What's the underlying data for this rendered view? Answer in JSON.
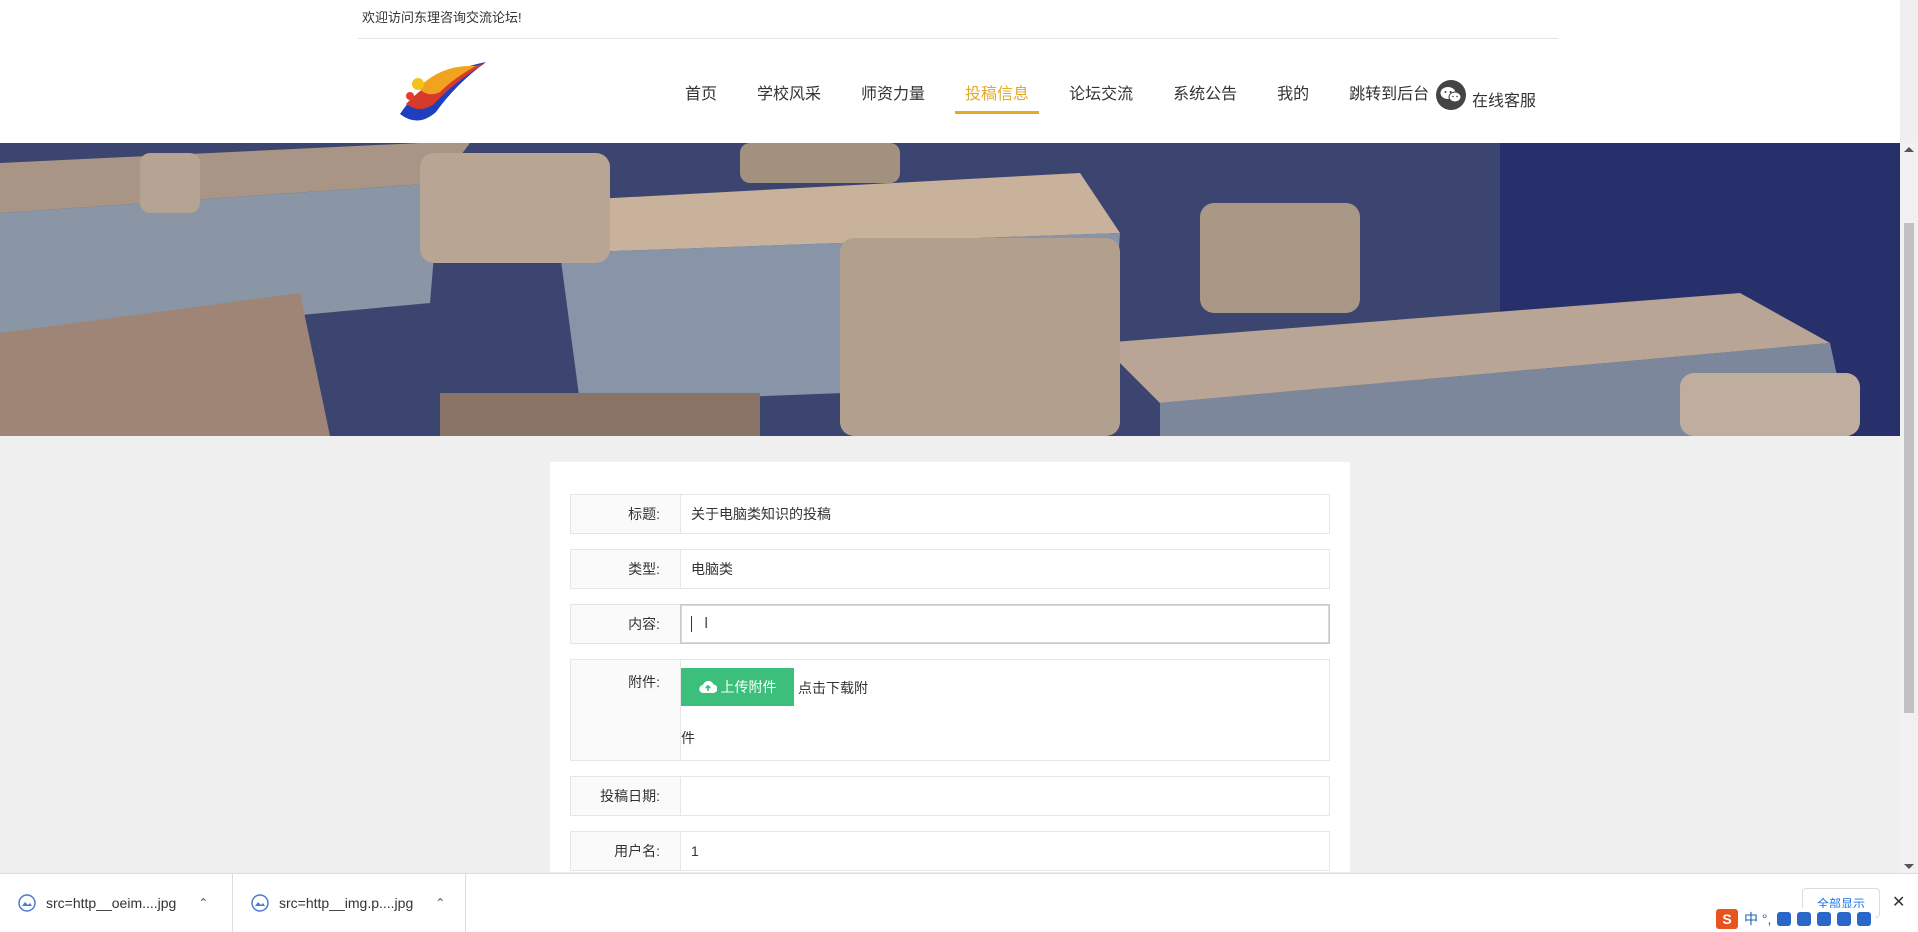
{
  "header": {
    "welcome": "欢迎访问东理咨询交流论坛!",
    "nav": [
      {
        "label": "首页"
      },
      {
        "label": "学校风采"
      },
      {
        "label": "师资力量"
      },
      {
        "label": "投稿信息",
        "active": true
      },
      {
        "label": "论坛交流"
      },
      {
        "label": "系统公告"
      },
      {
        "label": "我的"
      },
      {
        "label": "跳转到后台"
      }
    ],
    "service_label": "在线客服",
    "active_color": "#e2a92a"
  },
  "form": {
    "title_label": "标题:",
    "title_value": "关于电脑类知识的投稿",
    "type_label": "类型:",
    "type_value": "电脑类",
    "content_label": "内容:",
    "content_value": "",
    "attach_label": "附件:",
    "upload_label": "上传附件",
    "download_text_1": "点击下载附",
    "download_text_2": "件",
    "date_label": "投稿日期:",
    "date_value": "",
    "user_label": "用户名:",
    "user_value": "1",
    "upload_color": "#3bbf7b"
  },
  "downloads": {
    "items": [
      {
        "name": "src=http__oeim....jpg"
      },
      {
        "name": "src=http__img.p....jpg"
      }
    ],
    "show_all": "全部显示"
  },
  "ime": {
    "logo": "S",
    "text": "中 °,"
  }
}
